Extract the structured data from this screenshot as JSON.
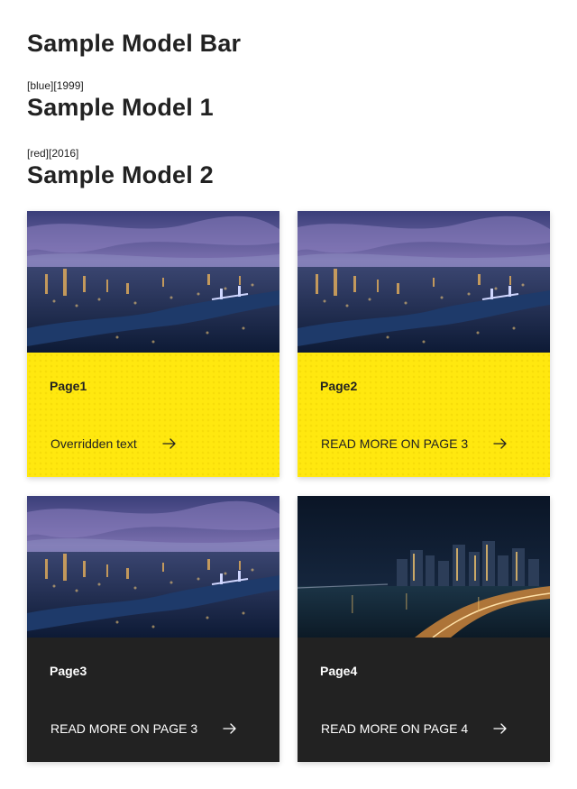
{
  "header": {
    "title": "Sample Model Bar"
  },
  "models": [
    {
      "meta": "[blue][1999]",
      "name": "Sample Model 1"
    },
    {
      "meta": "[red][2016]",
      "name": "Sample Model 2"
    }
  ],
  "cards": [
    {
      "title": "Page1",
      "link_label": "Overridden text",
      "style": "yellow",
      "image": "city-aerial-dusk"
    },
    {
      "title": "Page2",
      "link_label": "READ MORE ON PAGE 3",
      "style": "yellow",
      "image": "city-aerial-dusk"
    },
    {
      "title": "Page3",
      "link_label": "READ MORE ON PAGE 3",
      "style": "dark",
      "image": "city-aerial-dusk"
    },
    {
      "title": "Page4",
      "link_label": "READ MORE ON PAGE 4",
      "style": "dark",
      "image": "city-skyline-night"
    }
  ],
  "colors": {
    "accent_yellow": "#ffe80f",
    "dark": "#222222",
    "text": "#222222"
  },
  "icons": {
    "link_arrow": "arrow-right-icon"
  }
}
